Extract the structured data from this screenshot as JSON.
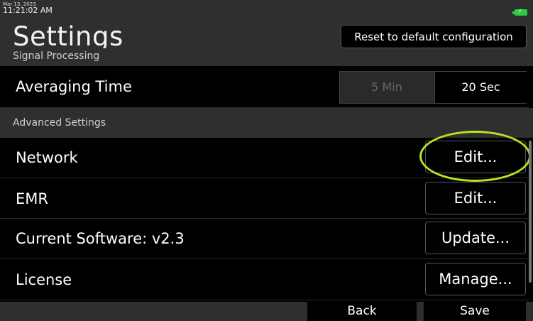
{
  "status": {
    "date": "Mar 13, 2023",
    "time": "11:21:02 AM",
    "battery_icon": "battery-charging-icon"
  },
  "header": {
    "title": "Settings",
    "reset_label": "Reset to default configuration"
  },
  "signal_processing": {
    "header": "Signal Processing",
    "averaging_time": {
      "label": "Averaging Time",
      "options": [
        "5 Min",
        "20 Sec"
      ],
      "selected": "20 Sec"
    }
  },
  "advanced": {
    "header": "Advanced Settings",
    "rows": [
      {
        "label": "Network",
        "button": "Edit..."
      },
      {
        "label": "EMR",
        "button": "Edit..."
      },
      {
        "label": "Current Software: v2.3",
        "button": "Update..."
      },
      {
        "label": "License",
        "button": "Manage..."
      }
    ]
  },
  "footer": {
    "back_label": "Back",
    "save_label": "Save"
  },
  "colors": {
    "accent_highlight": "#b5e61d",
    "battery": "#2ecc40"
  }
}
